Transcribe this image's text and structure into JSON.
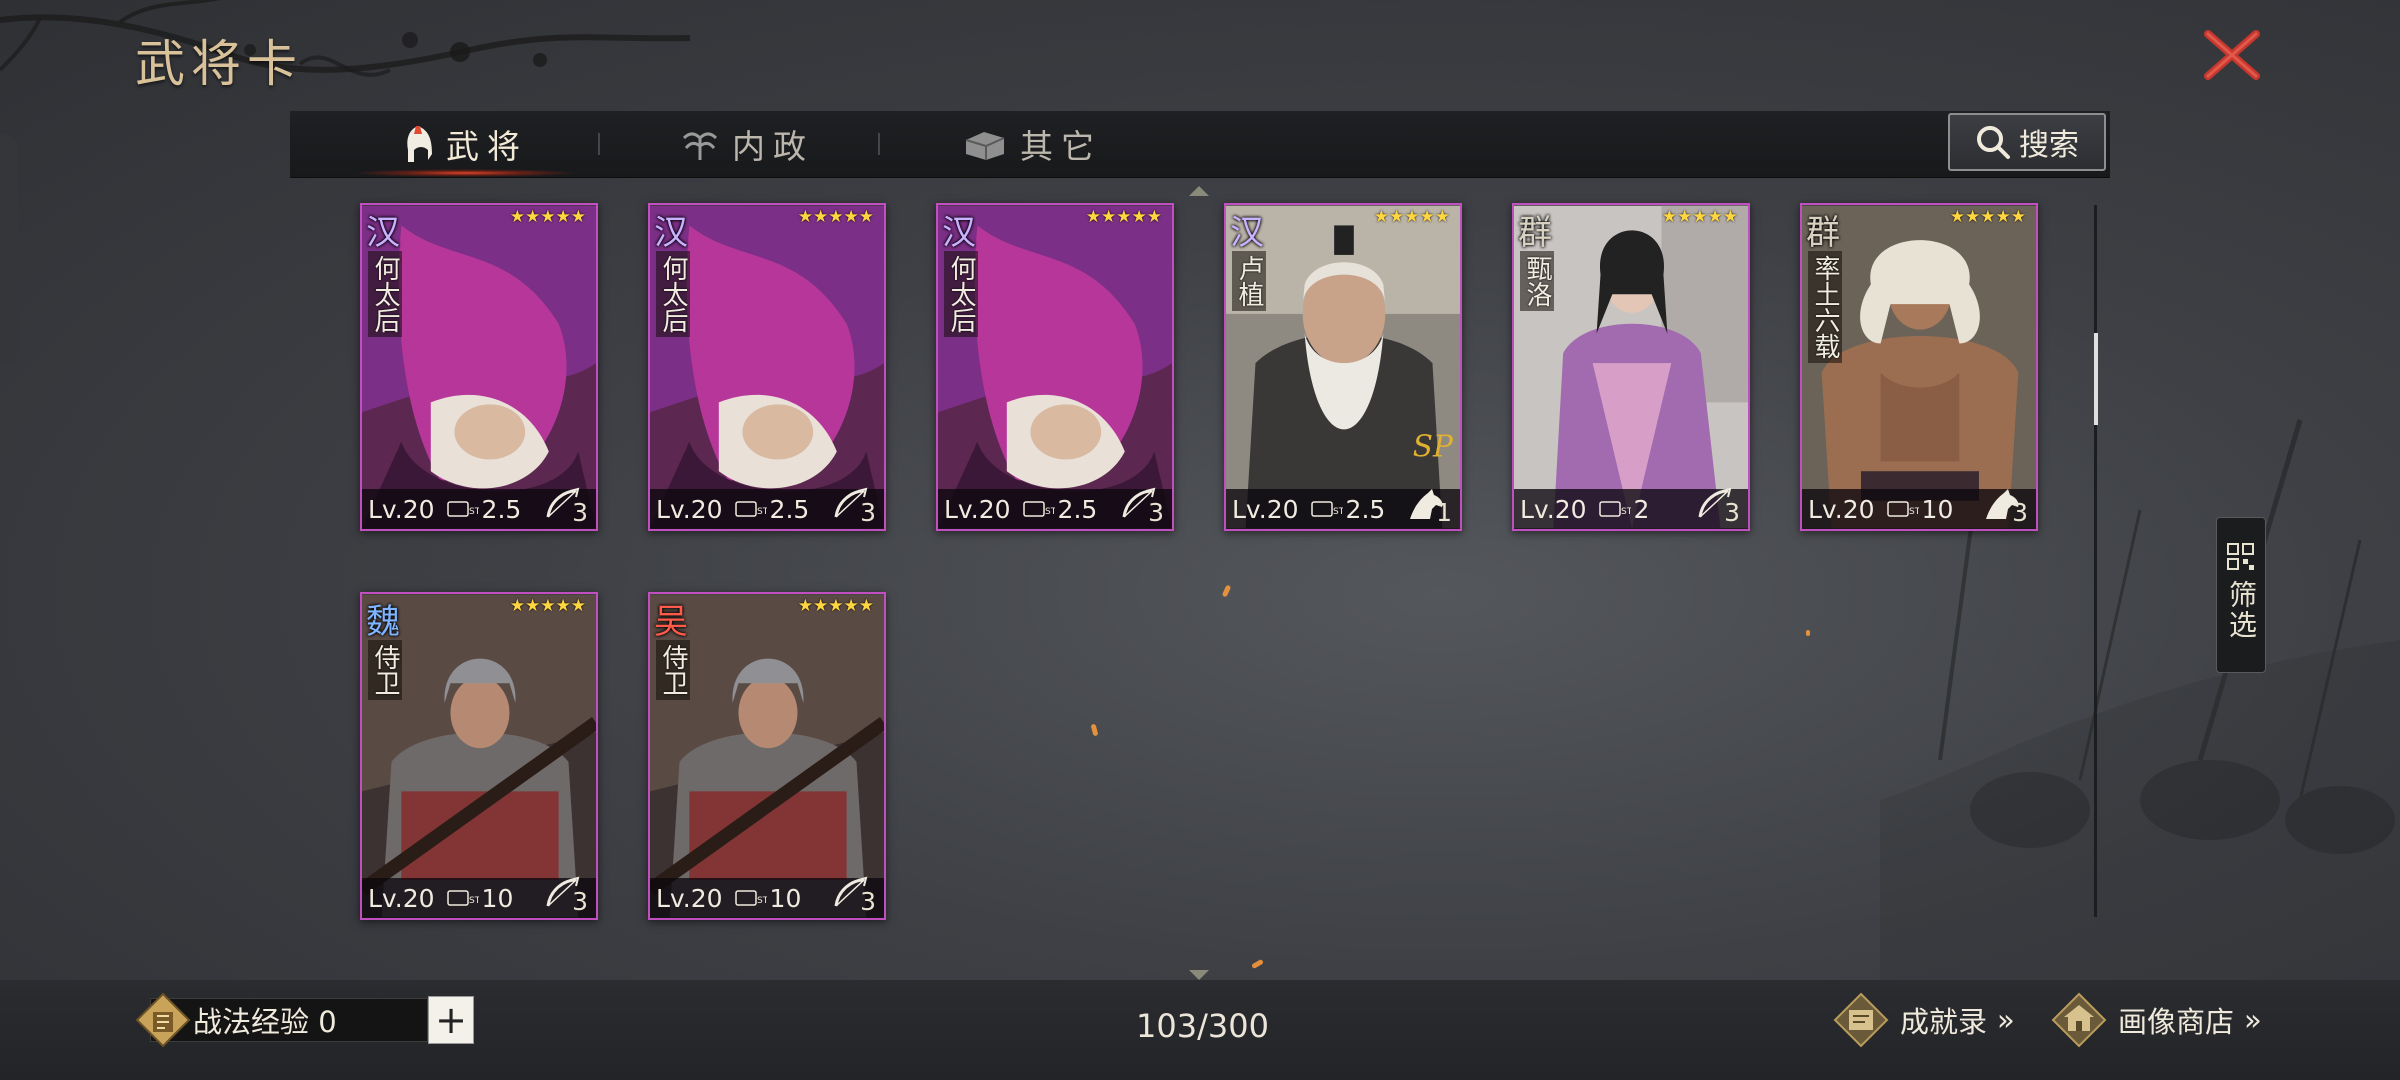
{
  "header": {
    "title": "武将卡"
  },
  "tabs": [
    {
      "label": "武将",
      "icon": "helmet-icon",
      "active": true
    },
    {
      "label": "内政",
      "icon": "plant-icon",
      "active": false
    },
    {
      "label": "其它",
      "icon": "box-icon",
      "active": false
    }
  ],
  "search": {
    "label": "搜索",
    "icon": "search-icon"
  },
  "filter": {
    "label": "筛选",
    "icon": "grid-icon"
  },
  "cards": [
    {
      "faction": "汉",
      "name": "何太后",
      "stars": "★★★★★",
      "level": "Lv.20",
      "cost": "2.5",
      "count": "3",
      "type": "bow-icon",
      "faction_color": "#c7b3ff"
    },
    {
      "faction": "汉",
      "name": "何太后",
      "stars": "★★★★★",
      "level": "Lv.20",
      "cost": "2.5",
      "count": "3",
      "type": "bow-icon",
      "faction_color": "#c7b3ff"
    },
    {
      "faction": "汉",
      "name": "何太后",
      "stars": "★★★★★",
      "level": "Lv.20",
      "cost": "2.5",
      "count": "3",
      "type": "bow-icon",
      "faction_color": "#c7b3ff"
    },
    {
      "faction": "汉",
      "name": "卢植",
      "stars": "★★★★★",
      "level": "Lv.20",
      "cost": "2.5",
      "count": "1",
      "type": "horse-icon",
      "faction_color": "#c7b3ff",
      "badge": "SP"
    },
    {
      "faction": "群",
      "name": "甄洛",
      "stars": "★★★★★",
      "level": "Lv.20",
      "cost": "2",
      "count": "3",
      "type": "bow-icon",
      "faction_color": "#d8d0c0"
    },
    {
      "faction": "群",
      "name": "率土六载",
      "stars": "★★★★★",
      "level": "Lv.20",
      "cost": "10",
      "count": "3",
      "type": "horse-icon",
      "faction_color": "#d8d0c0"
    },
    {
      "faction": "魏",
      "name": "侍卫",
      "stars": "★★★★★",
      "level": "Lv.20",
      "cost": "10",
      "count": "3",
      "type": "bow-icon",
      "faction_color": "#7fb4ff"
    },
    {
      "faction": "吴",
      "name": "侍卫",
      "stars": "★★★★★",
      "level": "Lv.20",
      "cost": "10",
      "count": "3",
      "type": "bow-icon",
      "faction_color": "#ff5a4a"
    }
  ],
  "footer": {
    "exp_label": "战法经验 0",
    "plus": "+",
    "counter": "103/300",
    "achievements": "成就录",
    "portrait_shop": "画像商店",
    "arrows": "»"
  }
}
